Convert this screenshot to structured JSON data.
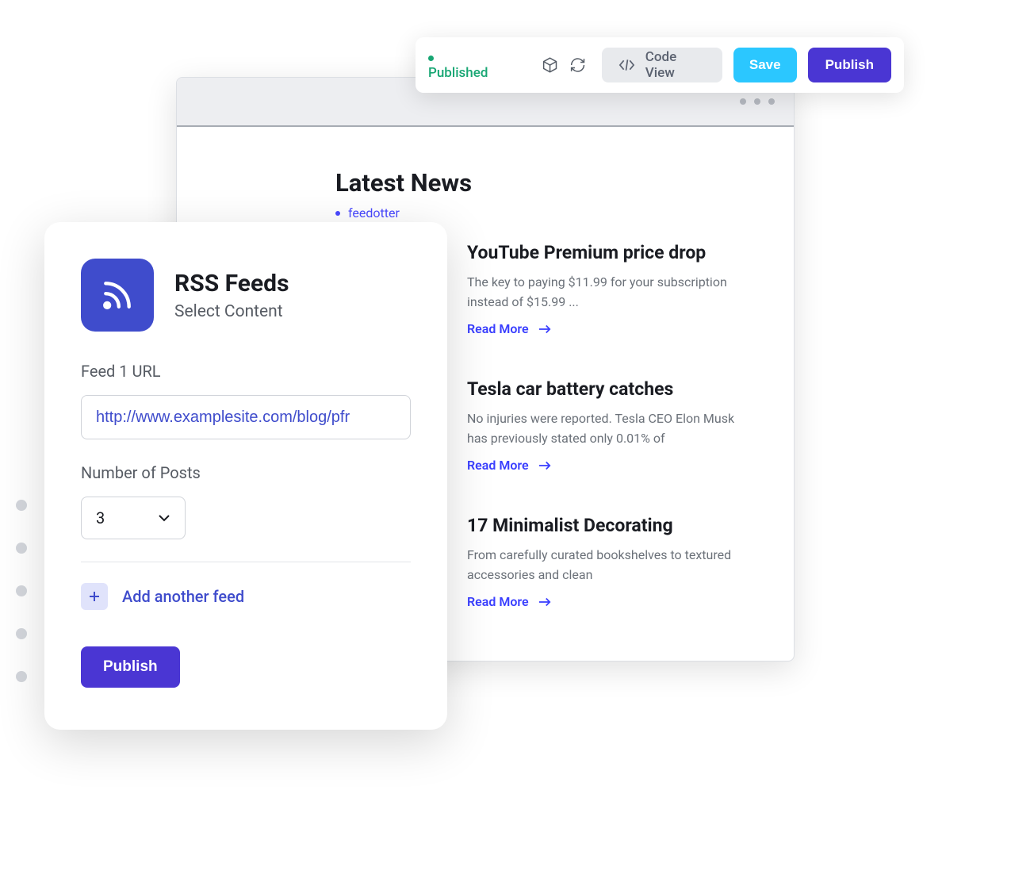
{
  "toolbar": {
    "status_label": "Published",
    "codeview_label": "Code View",
    "save_label": "Save",
    "publish_label": "Publish"
  },
  "preview": {
    "title": "Latest News",
    "source": "feedotter",
    "read_more_label": "Read More",
    "items": [
      {
        "title": "YouTube Premium price drop",
        "excerpt": "The key to paying $11.99 for your subscription instead of $15.99 ..."
      },
      {
        "title": "Tesla car battery catches",
        "excerpt": "No injuries were reported. Tesla CEO Elon Musk has previously stated only 0.01% of"
      },
      {
        "title": "17 Minimalist Decorating",
        "excerpt": "From carefully curated bookshelves to textured accessories and clean"
      }
    ]
  },
  "rss": {
    "heading": "RSS Feeds",
    "sub": "Select Content",
    "feed_url_label": "Feed 1 URL",
    "feed_url_value": "http://www.examplesite.com/blog/pfr",
    "posts_label": "Number of Posts",
    "posts_value": "3",
    "add_feed_label": "Add another feed",
    "publish_label": "Publish"
  }
}
